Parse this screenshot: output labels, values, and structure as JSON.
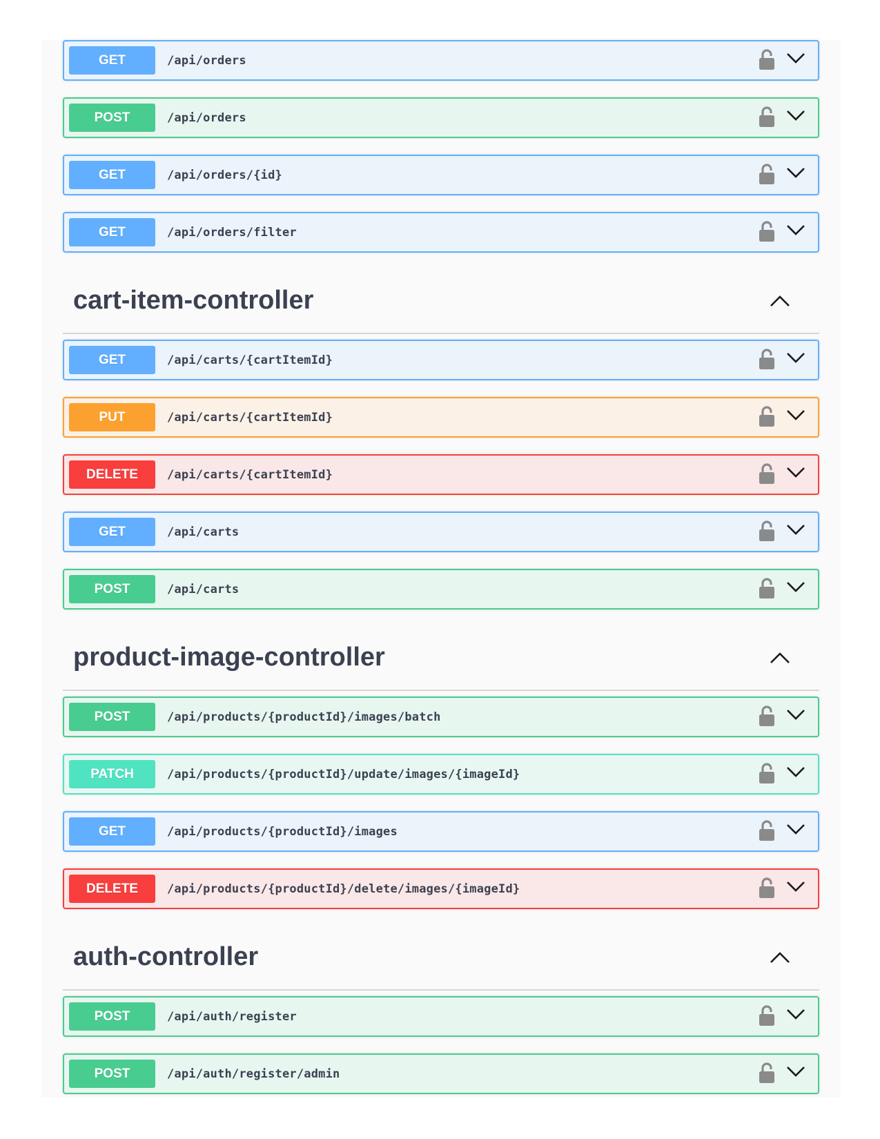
{
  "groups": [
    {
      "title": "",
      "ops": [
        {
          "method": "GET",
          "path": "/api/orders"
        },
        {
          "method": "POST",
          "path": "/api/orders"
        },
        {
          "method": "GET",
          "path": "/api/orders/{id}"
        },
        {
          "method": "GET",
          "path": "/api/orders/filter"
        }
      ]
    },
    {
      "title": "cart-item-controller",
      "ops": [
        {
          "method": "GET",
          "path": "/api/carts/{cartItemId}"
        },
        {
          "method": "PUT",
          "path": "/api/carts/{cartItemId}"
        },
        {
          "method": "DELETE",
          "path": "/api/carts/{cartItemId}"
        },
        {
          "method": "GET",
          "path": "/api/carts"
        },
        {
          "method": "POST",
          "path": "/api/carts"
        }
      ]
    },
    {
      "title": "product-image-controller",
      "ops": [
        {
          "method": "POST",
          "path": "/api/products/{productId}/images/batch"
        },
        {
          "method": "PATCH",
          "path": "/api/products/{productId}/update/images/{imageId}"
        },
        {
          "method": "GET",
          "path": "/api/products/{productId}/images"
        },
        {
          "method": "DELETE",
          "path": "/api/products/{productId}/delete/images/{imageId}"
        }
      ]
    },
    {
      "title": "auth-controller",
      "ops": [
        {
          "method": "POST",
          "path": "/api/auth/register"
        },
        {
          "method": "POST",
          "path": "/api/auth/register/admin"
        }
      ]
    }
  ],
  "icons": {
    "lock": "lock-icon",
    "expand": "chevron-down-icon",
    "collapse": "chevron-up-icon"
  },
  "colors": {
    "GET": "#61affe",
    "POST": "#49cc90",
    "PUT": "#fca130",
    "DELETE": "#f93e3e",
    "PATCH": "#50e3c2"
  }
}
